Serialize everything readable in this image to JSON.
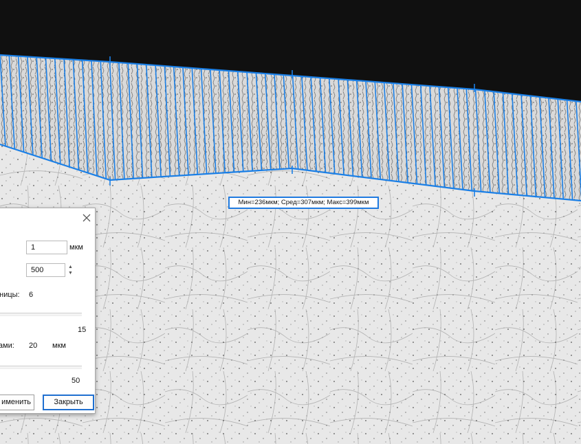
{
  "colors": {
    "measure_line": "#1a7fe6",
    "dark_region": "#101010",
    "background_region": "#eaeaea",
    "dialog_button_border": "#1e6fd0"
  },
  "measurement": {
    "summary": "Мин=236мкм; Сред=307мкм; Макс=399мкм"
  },
  "dialog": {
    "close_icon": "close-icon",
    "field1": {
      "value": "1",
      "unit": "мкм"
    },
    "field2": {
      "value": "500"
    },
    "boundary_label": "аницы:",
    "boundary_value": "6",
    "slider1_value": "15",
    "step_label": "тами:",
    "step_value": "20",
    "step_unit": "мкм",
    "slider2_value": "50",
    "apply_button": "именить",
    "close_button": "Закрыть"
  }
}
